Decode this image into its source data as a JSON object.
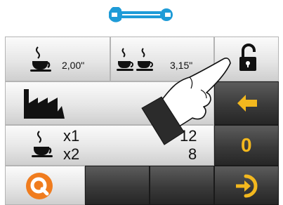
{
  "header": {
    "icon": "wrench-icon",
    "accent": "#1e9bd7"
  },
  "dose_row": {
    "single": {
      "icon": "cup-icon",
      "value": "2,00\""
    },
    "double": {
      "icon": "double-cup-icon",
      "value": "3,15\""
    },
    "lock": {
      "icon": "unlock-icon"
    }
  },
  "factory_row": {
    "icon": "factory-icon",
    "back": {
      "icon": "arrow-left-icon"
    }
  },
  "counter_row": {
    "labels": [
      "x1",
      "x2"
    ],
    "values": [
      "12",
      "8"
    ],
    "reset": {
      "label": "0"
    }
  },
  "bottom_row": {
    "logo": "q-logo-icon",
    "enter": {
      "icon": "login-icon"
    }
  },
  "colors": {
    "yellow": "#f3b81e",
    "orange": "#f07c1e",
    "dark": "#333333"
  }
}
